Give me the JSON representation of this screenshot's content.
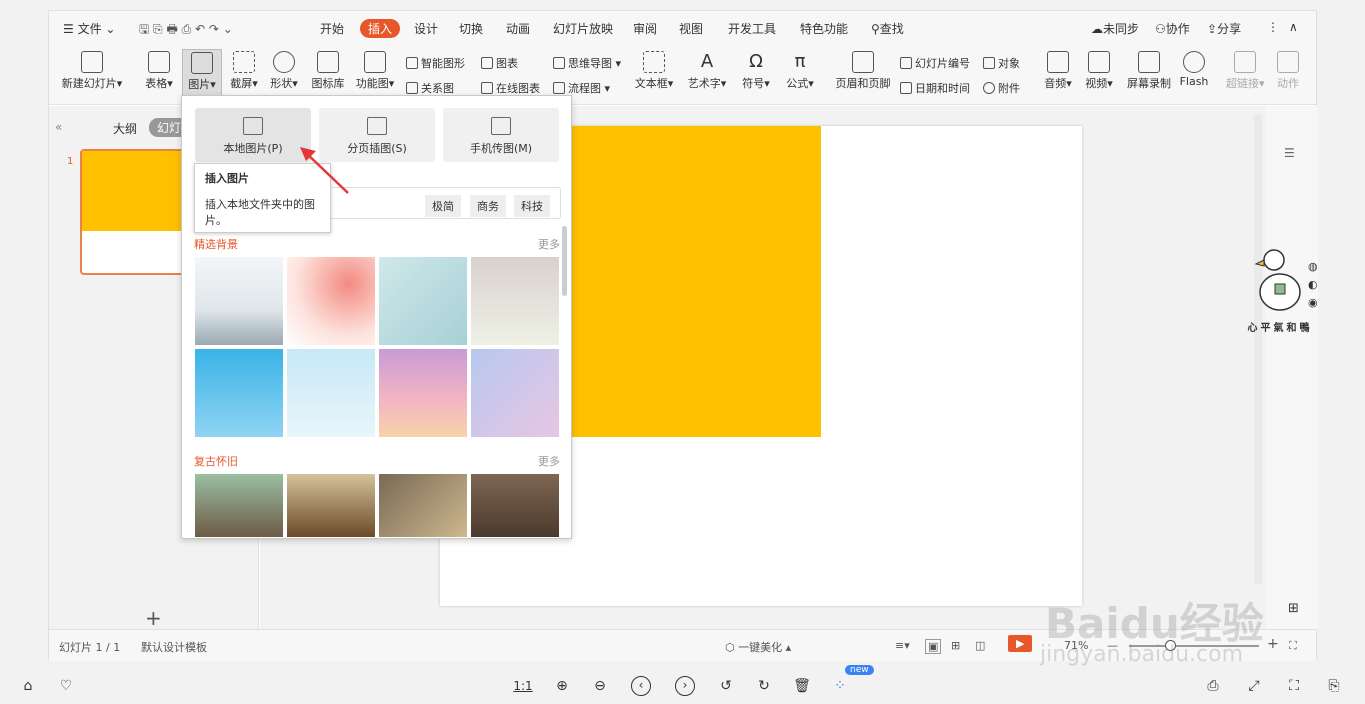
{
  "titlebar": {
    "file_menu": "文件",
    "tabs": [
      "开始",
      "插入",
      "设计",
      "切换",
      "动画",
      "幻灯片放映",
      "审阅",
      "视图",
      "开发工具",
      "特色功能"
    ],
    "active_tab": "插入",
    "search": "查找",
    "sync": "未同步",
    "collab": "协作",
    "share": "分享"
  },
  "ribbon": {
    "new_slide": "新建幻灯片",
    "table": "表格",
    "picture": "图片",
    "screenshot": "截屏",
    "shape": "形状",
    "icon_lib": "图标库",
    "func_chart": "功能图",
    "smart_shape": "智能图形",
    "chart": "图表",
    "relation": "关系图",
    "online_chart": "在线图表",
    "mindmap": "思维导图",
    "flowchart": "流程图",
    "textbox": "文本框",
    "art_text": "艺术字",
    "symbol": "符号",
    "formula": "公式",
    "header_footer": "页眉和页脚",
    "slide_number": "幻灯片编号",
    "object": "对象",
    "date_time": "日期和时间",
    "attachment": "附件",
    "audio": "音频",
    "video": "视频",
    "screen_record": "屏幕录制",
    "flash": "Flash",
    "hyperlink": "超链接",
    "action": "动作"
  },
  "leftpane": {
    "outline_tab": "大纲",
    "slides_tab": "幻灯片",
    "slide_number": "1",
    "add": "+"
  },
  "dropdown": {
    "local_picture": "本地图片(P)",
    "page_insert": "分页插图(S)",
    "phone_picture": "手机传图(M)",
    "tags": [
      "极简",
      "商务",
      "科技"
    ],
    "section1": "精选背景",
    "section2": "复古怀旧",
    "more": "更多"
  },
  "tooltip": {
    "title": "插入图片",
    "desc": "插入本地文件夹中的图片。"
  },
  "status": {
    "slide_count": "幻灯片 1 / 1",
    "template": "默认设计模板",
    "beautify": "一键美化",
    "zoom": "71%"
  },
  "sticker": {
    "text": "心平氣和鴨"
  },
  "bottombar": {
    "ratio": "1:1",
    "new_badge": "new"
  },
  "watermark": {
    "line1": "Baidu经验",
    "line2": "jingyan.baidu.com"
  },
  "colors": {
    "accent": "#e8572a",
    "slide_fill": "#ffc000"
  }
}
